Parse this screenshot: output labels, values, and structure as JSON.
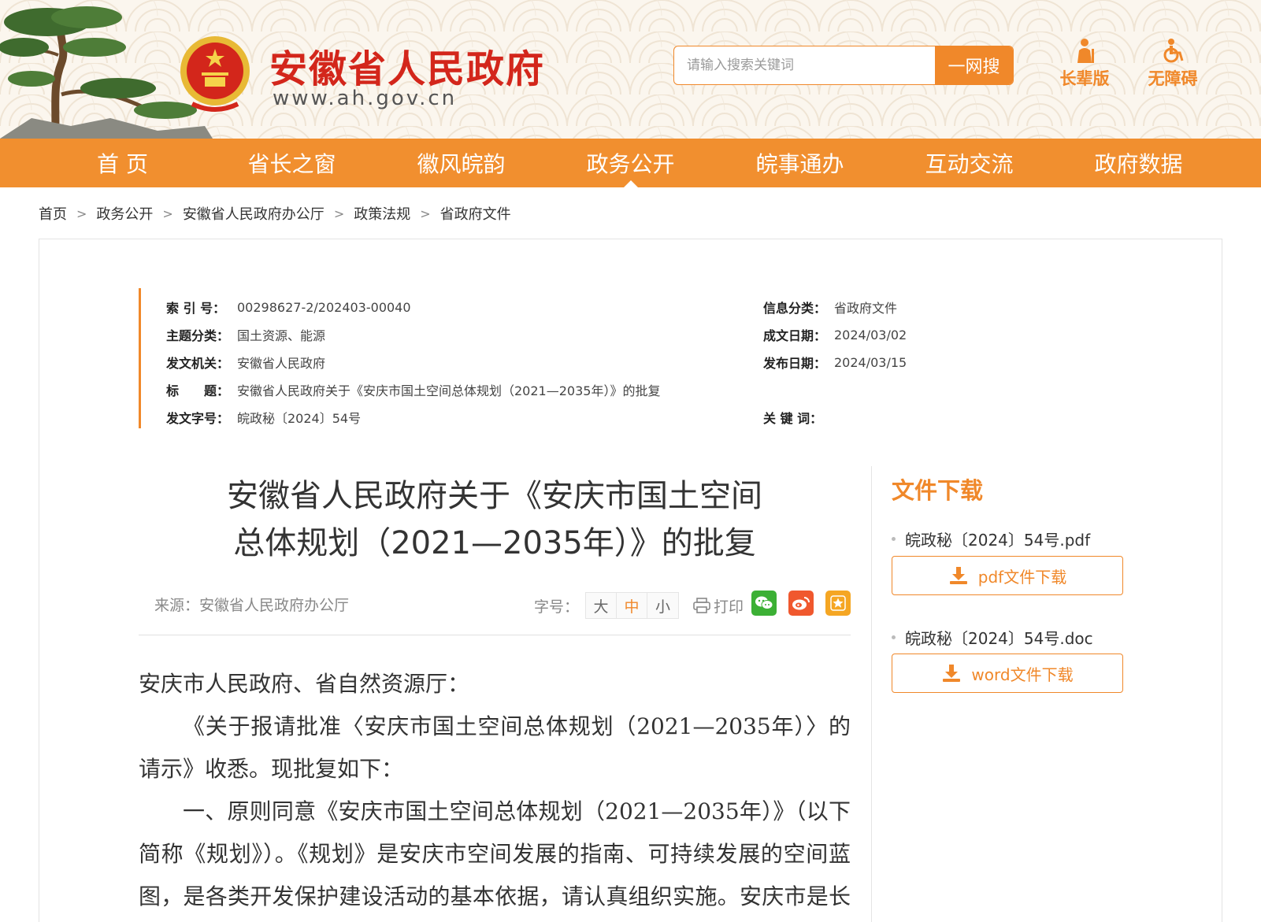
{
  "header": {
    "site_title": "安徽省人民政府",
    "site_url": "www.ah.gov.cn",
    "search_placeholder": "请输入搜索关键词",
    "search_button": "一网搜",
    "elder_mode": "长辈版",
    "accessibility_mode": "无障碍"
  },
  "nav": {
    "items": [
      "首 页",
      "省长之窗",
      "徽风皖韵",
      "政务公开",
      "皖事通办",
      "互动交流",
      "政府数据"
    ],
    "active_index": 3
  },
  "breadcrumb": [
    "首页",
    "政务公开",
    "安徽省人民政府办公厅",
    "政策法规",
    "省政府文件"
  ],
  "meta": {
    "index_label": "索 引 号：",
    "index_value": "00298627-2/202403-00040",
    "category_label": "信息分类：",
    "category_value": "省政府文件",
    "topic_label": "主题分类：",
    "topic_value": "国土资源、能源",
    "created_label": "成文日期：",
    "created_value": "2024/03/02",
    "issuer_label": "发文机关：",
    "issuer_value": "安徽省人民政府",
    "published_label": "发布日期：",
    "published_value": "2024/03/15",
    "title_label": "标　　题：",
    "title_value": "安徽省人民政府关于《安庆市国土空间总体规划（2021—2035年）》的批复",
    "doc_no_label": "发文字号：",
    "doc_no_value": "皖政秘〔2024〕54号",
    "keywords_label": "关 键 词：",
    "keywords_value": ""
  },
  "article": {
    "title_line1": "安徽省人民政府关于《安庆市国土空间",
    "title_line2": "总体规划（2021—2035年）》的批复",
    "source": "来源：安徽省人民政府办公厅",
    "font_size_label": "字号：",
    "font_sizes": [
      "大",
      "中",
      "小"
    ],
    "font_size_active": "中",
    "print_label": "打印",
    "paragraphs": [
      "安庆市人民政府、省自然资源厅：",
      "《关于报请批准〈安庆市国土空间总体规划（2021—2035年）〉的请示》收悉。现批复如下：",
      "一、原则同意《安庆市国土空间总体规划（2021—2035年）》（以下简称《规划》）。《规划》是安庆市空间发展的指南、可持续发展的空间蓝图，是各类开发保护建设活动的基本依据，请认真组织实施。安庆市是长三"
    ]
  },
  "downloads": {
    "title": "文件下载",
    "files": [
      {
        "name": "皖政秘〔2024〕54号.pdf",
        "button": "pdf文件下载"
      },
      {
        "name": "皖政秘〔2024〕54号.doc",
        "button": "word文件下载"
      }
    ]
  },
  "colors": {
    "brand_orange": "#f0882a",
    "title_red": "#d3261b",
    "wechat_green": "#3cb035",
    "weibo_red": "#f0582e",
    "favorite_yellow": "#f5a623"
  }
}
